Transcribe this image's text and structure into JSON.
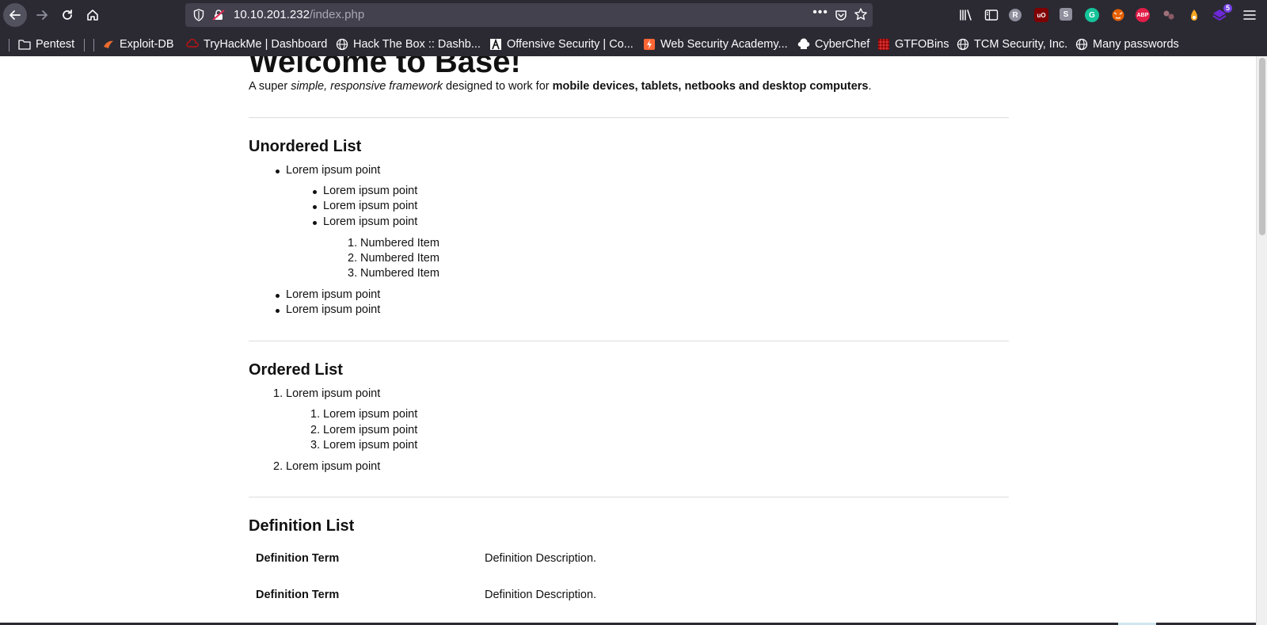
{
  "browser": {
    "url_host": "10.10.201.232",
    "url_path": "/index.php",
    "url_more": "•••",
    "extension_badge": "5",
    "colors": {
      "chrome": "#2b2a33",
      "urlbar": "#42414d",
      "text": "#fbfbfe"
    },
    "extensions": [
      {
        "name": "library-icon"
      },
      {
        "name": "sidebar-icon"
      },
      {
        "name": "r-extension-icon",
        "label": "R",
        "color": "#8f8f9d"
      },
      {
        "name": "ublock-icon",
        "label": "uO",
        "color": "#800000"
      },
      {
        "name": "stylus-icon",
        "label": "S",
        "color": "#8f8f9d"
      },
      {
        "name": "grammarly-icon",
        "label": "G",
        "color": "#15c39a"
      },
      {
        "name": "foxyproxy-icon",
        "color": "#e66000"
      },
      {
        "name": "adblock-plus-icon",
        "label": "ABP",
        "color": "#e11d48"
      },
      {
        "name": "cookie-editor-icon",
        "color": "#a0707a"
      },
      {
        "name": "wappalyzer-icon",
        "color": "#f5a623"
      },
      {
        "name": "multi-account-icon",
        "color": "#6d28d9"
      }
    ]
  },
  "bookmarks": [
    {
      "label": "Pentest",
      "icon": "folder-icon"
    },
    {
      "label": "Exploit-DB",
      "icon": "exploit-db-icon"
    },
    {
      "label": "TryHackMe | Dashboard",
      "icon": "tryhackme-icon"
    },
    {
      "label": "Hack The Box :: Dashb...",
      "icon": "globe-icon"
    },
    {
      "label": "Offensive Security | Co...",
      "icon": "offsec-icon"
    },
    {
      "label": "Web Security Academy...",
      "icon": "portswigger-icon"
    },
    {
      "label": "CyberChef",
      "icon": "chef-hat-icon"
    },
    {
      "label": "GTFOBins",
      "icon": "gtfobins-icon"
    },
    {
      "label": "TCM Security, Inc.",
      "icon": "globe-icon"
    },
    {
      "label": "Many passwords",
      "icon": "globe-icon"
    }
  ],
  "page": {
    "title": "Welcome to Base!",
    "lead": {
      "part1": "A super ",
      "em": "simple, responsive framework",
      "part2": " designed to work for ",
      "strong": "mobile devices, tablets, netbooks and desktop computers",
      "part3": "."
    },
    "unordered": {
      "heading": "Unordered List",
      "items": [
        "Lorem ipsum point",
        "Lorem ipsum point",
        "Lorem ipsum point",
        "Lorem ipsum point",
        "Numbered Item",
        "Numbered Item",
        "Numbered Item",
        "Lorem ipsum point",
        "Lorem ipsum point"
      ],
      "numbers": [
        "1.",
        "2.",
        "3."
      ]
    },
    "ordered": {
      "heading": "Ordered List",
      "items": [
        "Lorem ipsum point",
        "Lorem ipsum point",
        "Lorem ipsum point",
        "Lorem ipsum point",
        "Lorem ipsum point"
      ],
      "numbers": [
        "1.",
        "1.",
        "2.",
        "3.",
        "2."
      ]
    },
    "definition": {
      "heading": "Definition List",
      "rows": [
        {
          "term": "Definition Term",
          "desc": "Definition Description."
        },
        {
          "term": "Definition Term",
          "desc": "Definition Description."
        }
      ]
    }
  }
}
